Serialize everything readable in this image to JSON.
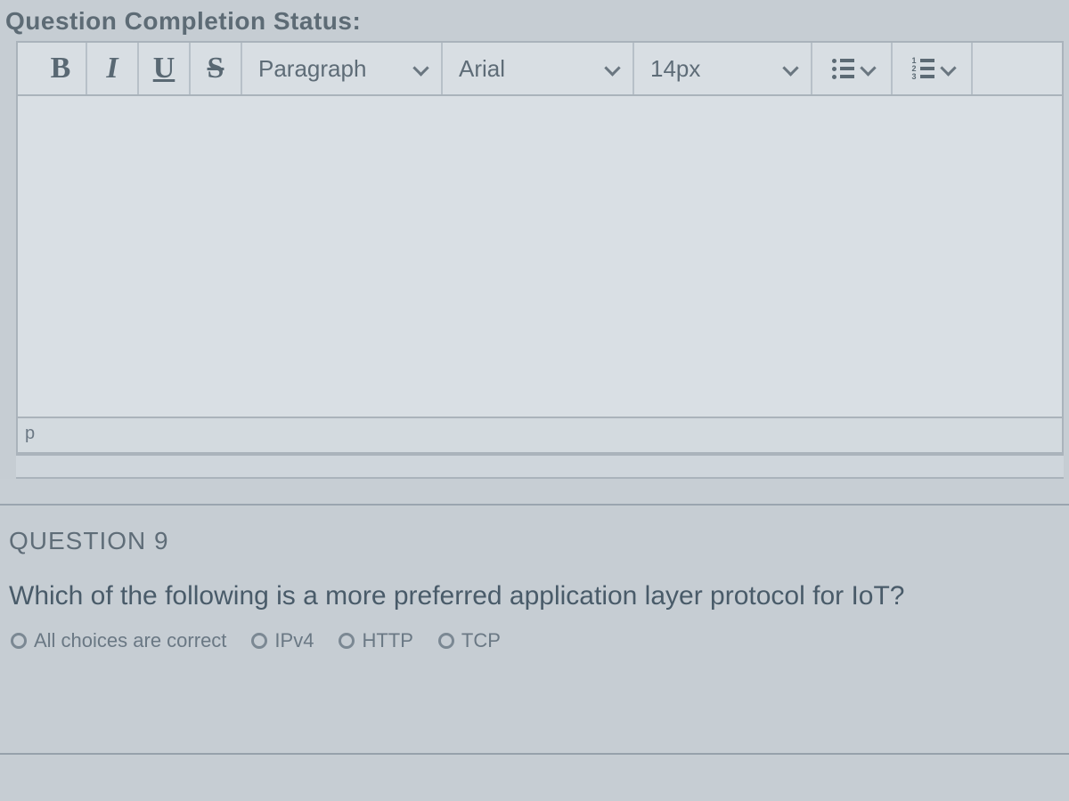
{
  "header": {
    "status_label": "Question Completion Status:"
  },
  "toolbar": {
    "bold": "B",
    "italic": "I",
    "underline": "U",
    "strike": "S",
    "paragraph_style": "Paragraph",
    "font_family": "Arial",
    "font_size": "14px"
  },
  "editor": {
    "content": "",
    "path": "p"
  },
  "question": {
    "number_label": "QUESTION 9",
    "prompt": "Which of the following is a more preferred application layer protocol for IoT?",
    "choices": [
      {
        "label": "All choices are correct"
      },
      {
        "label": "IPv4"
      },
      {
        "label": "HTTP"
      },
      {
        "label": "TCP"
      }
    ]
  }
}
